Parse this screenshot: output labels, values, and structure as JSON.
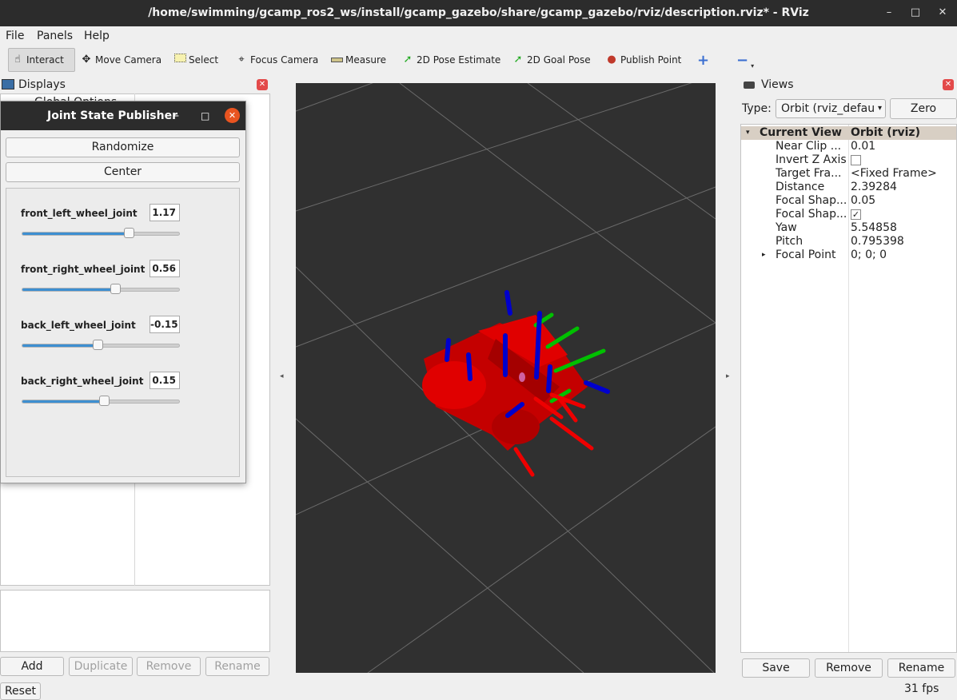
{
  "window": {
    "title": "/home/swimming/gcamp_ros2_ws/install/gcamp_gazebo/share/gcamp_gazebo/rviz/description.rviz* - RViz",
    "minimize": "–",
    "maximize": "□",
    "close": "✕"
  },
  "menu": {
    "file": "File",
    "panels": "Panels",
    "help": "Help"
  },
  "toolbar": {
    "interact": "Interact",
    "move_camera": "Move Camera",
    "select": "Select",
    "focus_camera": "Focus Camera",
    "measure": "Measure",
    "pose_estimate": "2D Pose Estimate",
    "goal_pose": "2D Goal Pose",
    "publish_point": "Publish Point",
    "add": "+",
    "remove": "−"
  },
  "displays": {
    "title": "Displays",
    "global_options": "Global Options",
    "buttons": {
      "add": "Add",
      "duplicate": "Duplicate",
      "remove": "Remove",
      "rename": "Rename"
    }
  },
  "joint_state_publisher": {
    "title": "Joint State Publisher",
    "randomize": "Randomize",
    "center": "Center",
    "joints": [
      {
        "name": "front_left_wheel_joint",
        "value": "1.17",
        "position": 0.68
      },
      {
        "name": "front_right_wheel_joint",
        "value": "0.56",
        "position": 0.59
      },
      {
        "name": "back_left_wheel_joint",
        "value": "-0.15",
        "position": 0.48
      },
      {
        "name": "back_right_wheel_joint",
        "value": "0.15",
        "position": 0.52
      }
    ]
  },
  "views": {
    "title": "Views",
    "type_label": "Type:",
    "type_value": "Orbit (rviz_defau",
    "zero": "Zero",
    "header": {
      "key": "Current View",
      "value": "Orbit (rviz)"
    },
    "properties": [
      {
        "key": "Near Clip ...",
        "value": "0.01"
      },
      {
        "key": "Invert Z Axis",
        "value": "",
        "checkbox": false
      },
      {
        "key": "Target Fra...",
        "value": "<Fixed Frame>"
      },
      {
        "key": "Distance",
        "value": "2.39284"
      },
      {
        "key": "Focal Shap...",
        "value": "0.05"
      },
      {
        "key": "Focal Shap...",
        "value": "",
        "checkbox": true
      },
      {
        "key": "Yaw",
        "value": "5.54858"
      },
      {
        "key": "Pitch",
        "value": "0.795398"
      },
      {
        "key": "Focal Point",
        "value": "0; 0; 0"
      }
    ],
    "buttons": {
      "save": "Save",
      "remove": "Remove",
      "rename": "Rename"
    }
  },
  "status": {
    "reset": "Reset",
    "fps": "31 fps"
  },
  "colors": {
    "robot": "#cc0000",
    "axis_x": "#ff0000",
    "axis_y": "#00cc00",
    "axis_z": "#0000cc",
    "viewport": "#303030"
  }
}
